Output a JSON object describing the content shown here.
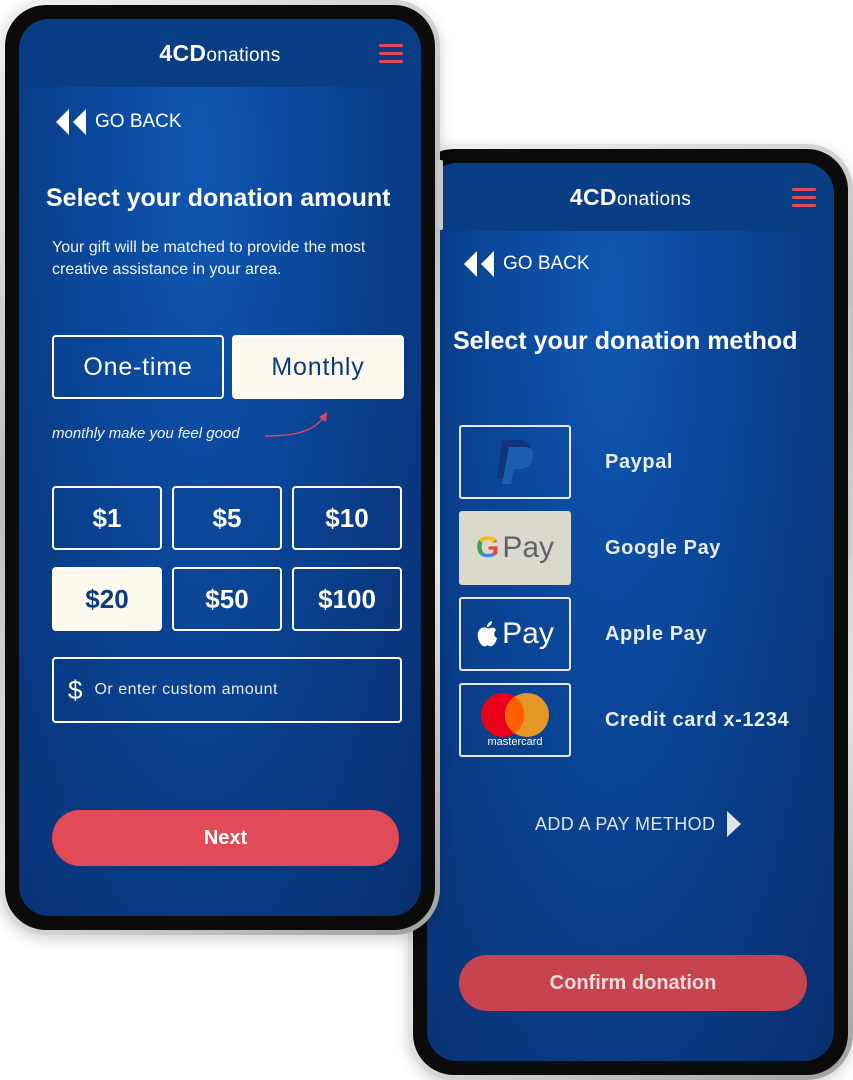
{
  "brand": {
    "logo_bold": "4CD",
    "logo_rest": "onations"
  },
  "amount_screen": {
    "back_label": "GO BACK",
    "title": "Select your donation amount",
    "subtitle_line1": "Your gift will be matched to provide the most",
    "subtitle_line2": "creative assistance in your area.",
    "frequency_options": [
      "One-time",
      "Monthly"
    ],
    "frequency_selected": "Monthly",
    "frequency_note": "monthly make you feel good",
    "amounts": [
      "$1",
      "$5",
      "$10",
      "$20",
      "$50",
      "$100"
    ],
    "amount_selected": "$20",
    "custom_symbol": "$",
    "custom_placeholder": "Or enter custom amount",
    "next_label": "Next"
  },
  "method_screen": {
    "back_label": "GO BACK",
    "title": "Select your donation method",
    "methods": [
      "Paypal",
      "Google Pay",
      "Apple Pay",
      "Credit card x-1234"
    ],
    "method_selected": "Google Pay",
    "gpay_mark": "Pay",
    "applepay_mark": "Pay",
    "mastercard_mark": "mastercard",
    "add_method_label": "ADD A PAY METHOD",
    "confirm_label": "Confirm donation"
  },
  "colors": {
    "accent": "#e24a57",
    "screen_blue": "#0a4393",
    "header_blue": "#0a3e84",
    "selected_fill": "#fdf9ef"
  },
  "icons": {
    "back": "rewind-icon",
    "menu": "hamburger-menu-icon",
    "add": "play-arrow-icon"
  }
}
